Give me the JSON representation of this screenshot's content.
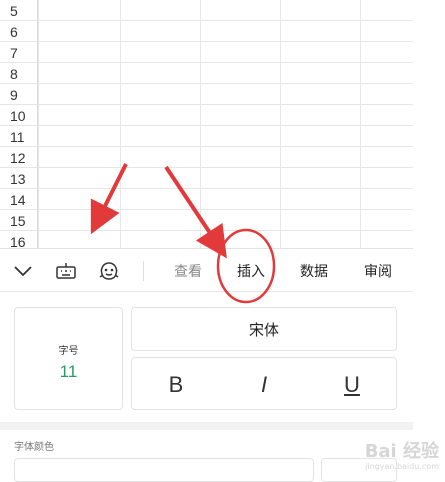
{
  "sheet": {
    "row_numbers": [
      "5",
      "6",
      "7",
      "8",
      "9",
      "10",
      "11",
      "12",
      "13",
      "14",
      "15",
      "16"
    ]
  },
  "toolbar": {
    "icons": [
      "chevron-down-icon",
      "keyboard-icon",
      "emoji-icon"
    ],
    "tabs": [
      {
        "label": "查看",
        "state": "dim"
      },
      {
        "label": "插入",
        "state": "normal"
      },
      {
        "label": "数据",
        "state": "normal"
      },
      {
        "label": "审阅",
        "state": "normal"
      }
    ]
  },
  "format_panel": {
    "font_size_label": "字号",
    "font_size_value": "11",
    "font_name": "宋体",
    "bold_label": "B",
    "italic_label": "I",
    "underline_label": "U",
    "font_color_label": "字体颜色"
  },
  "watermark": {
    "text": "Bai 经验",
    "subtext": "jingyan.baidu.com"
  },
  "colors": {
    "font_size_value": "#2a9a6a",
    "annotation_red": "#e23a3a",
    "panel_bg": "#f2f2f2"
  }
}
